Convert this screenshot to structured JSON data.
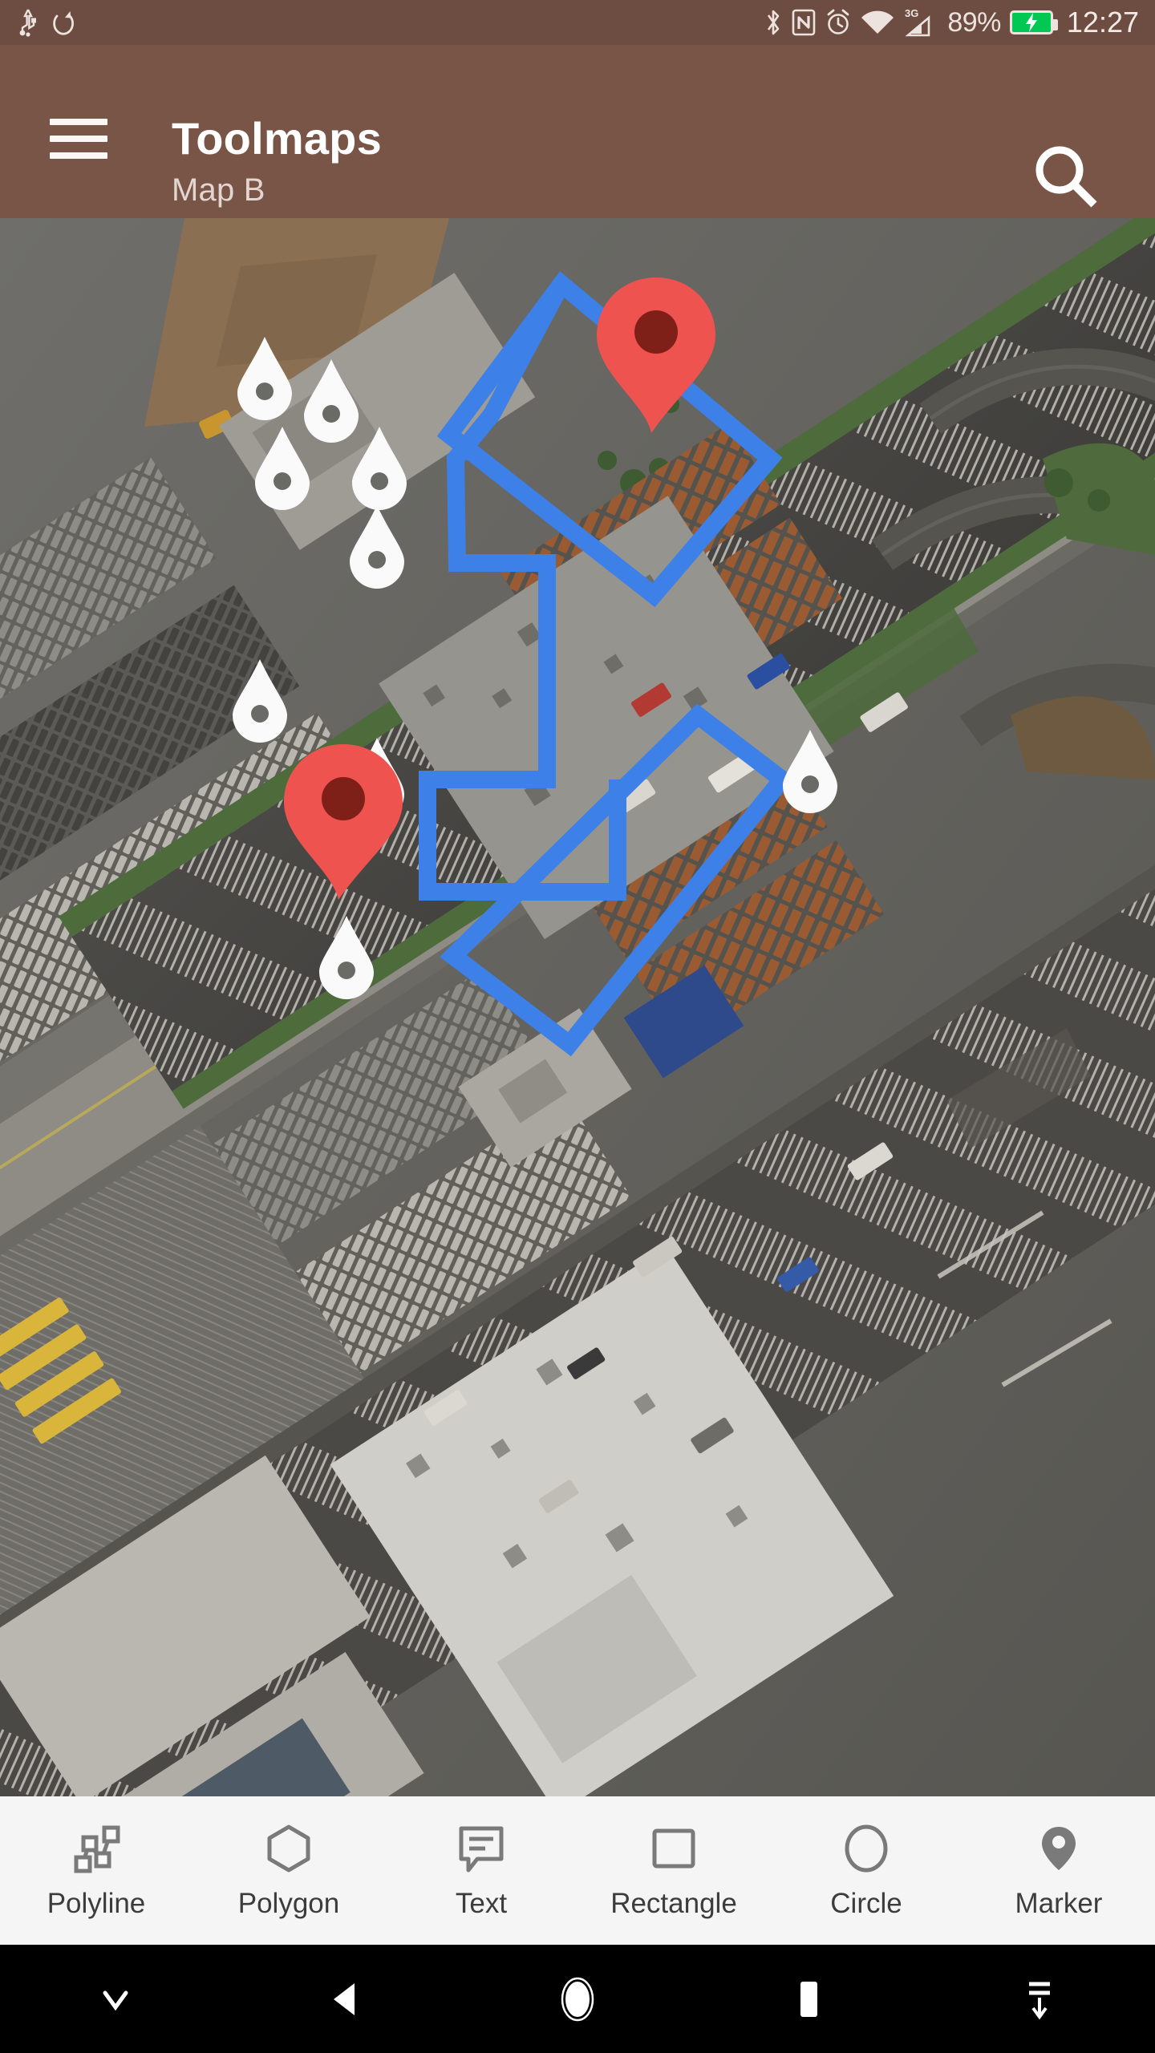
{
  "status_bar": {
    "background_color": "#6D4C41",
    "left_icons": [
      {
        "name": "usb-icon",
        "label": "USB"
      },
      {
        "name": "sync-icon",
        "label": "Sync"
      }
    ],
    "right_icons": [
      {
        "name": "bluetooth-icon",
        "label": "Bluetooth"
      },
      {
        "name": "nfc-icon",
        "label": "NFC"
      },
      {
        "name": "alarm-icon",
        "label": "Alarm"
      },
      {
        "name": "wifi-icon",
        "label": "Wi-Fi"
      },
      {
        "name": "mobile-signal-icon",
        "label": "3G"
      }
    ],
    "network_type": "3G",
    "battery_percent": "89%",
    "battery_charging": true,
    "battery_color": "#00C853",
    "clock": "12:27"
  },
  "app_bar": {
    "background_color": "#795548",
    "menu_icon": "hamburger-menu-icon",
    "title": "Toolmaps",
    "subtitle": "Map B",
    "search_icon": "search-icon"
  },
  "map": {
    "type": "satellite-imagery",
    "shape_stroke_color": "#3C80E8",
    "marker_color": "#EF5350",
    "marker_dot_color": "#7E2018",
    "vertex_marker_color": "#FAFAFA",
    "shapes": [
      {
        "name": "polygon-upper",
        "type": "polygon",
        "vertices": 4
      },
      {
        "name": "polygon-lower",
        "type": "rectangle",
        "vertices": 4
      },
      {
        "name": "polyline-route",
        "type": "polyline",
        "vertices": 7
      }
    ],
    "markers": [
      {
        "name": "marker-red-upper",
        "color": "#EF5350"
      },
      {
        "name": "marker-red-lower",
        "color": "#EF5350"
      }
    ]
  },
  "toolbar": {
    "background_color": "#F5F5F5",
    "items": [
      {
        "label": "Polyline",
        "icon": "polyline-icon"
      },
      {
        "label": "Polygon",
        "icon": "polygon-icon"
      },
      {
        "label": "Text",
        "icon": "text-bubble-icon"
      },
      {
        "label": "Rectangle",
        "icon": "rectangle-icon"
      },
      {
        "label": "Circle",
        "icon": "circle-icon"
      },
      {
        "label": "Marker",
        "icon": "marker-pin-icon"
      }
    ]
  },
  "nav_bar": {
    "background_color": "#000000",
    "buttons": [
      {
        "name": "hide-keyboard-button",
        "icon": "chevron-down-icon"
      },
      {
        "name": "back-button",
        "icon": "back-triangle-icon"
      },
      {
        "name": "home-button",
        "icon": "home-circle-icon"
      },
      {
        "name": "recents-button",
        "icon": "recents-square-icon"
      },
      {
        "name": "pulldown-button",
        "icon": "collapse-down-icon"
      }
    ]
  }
}
